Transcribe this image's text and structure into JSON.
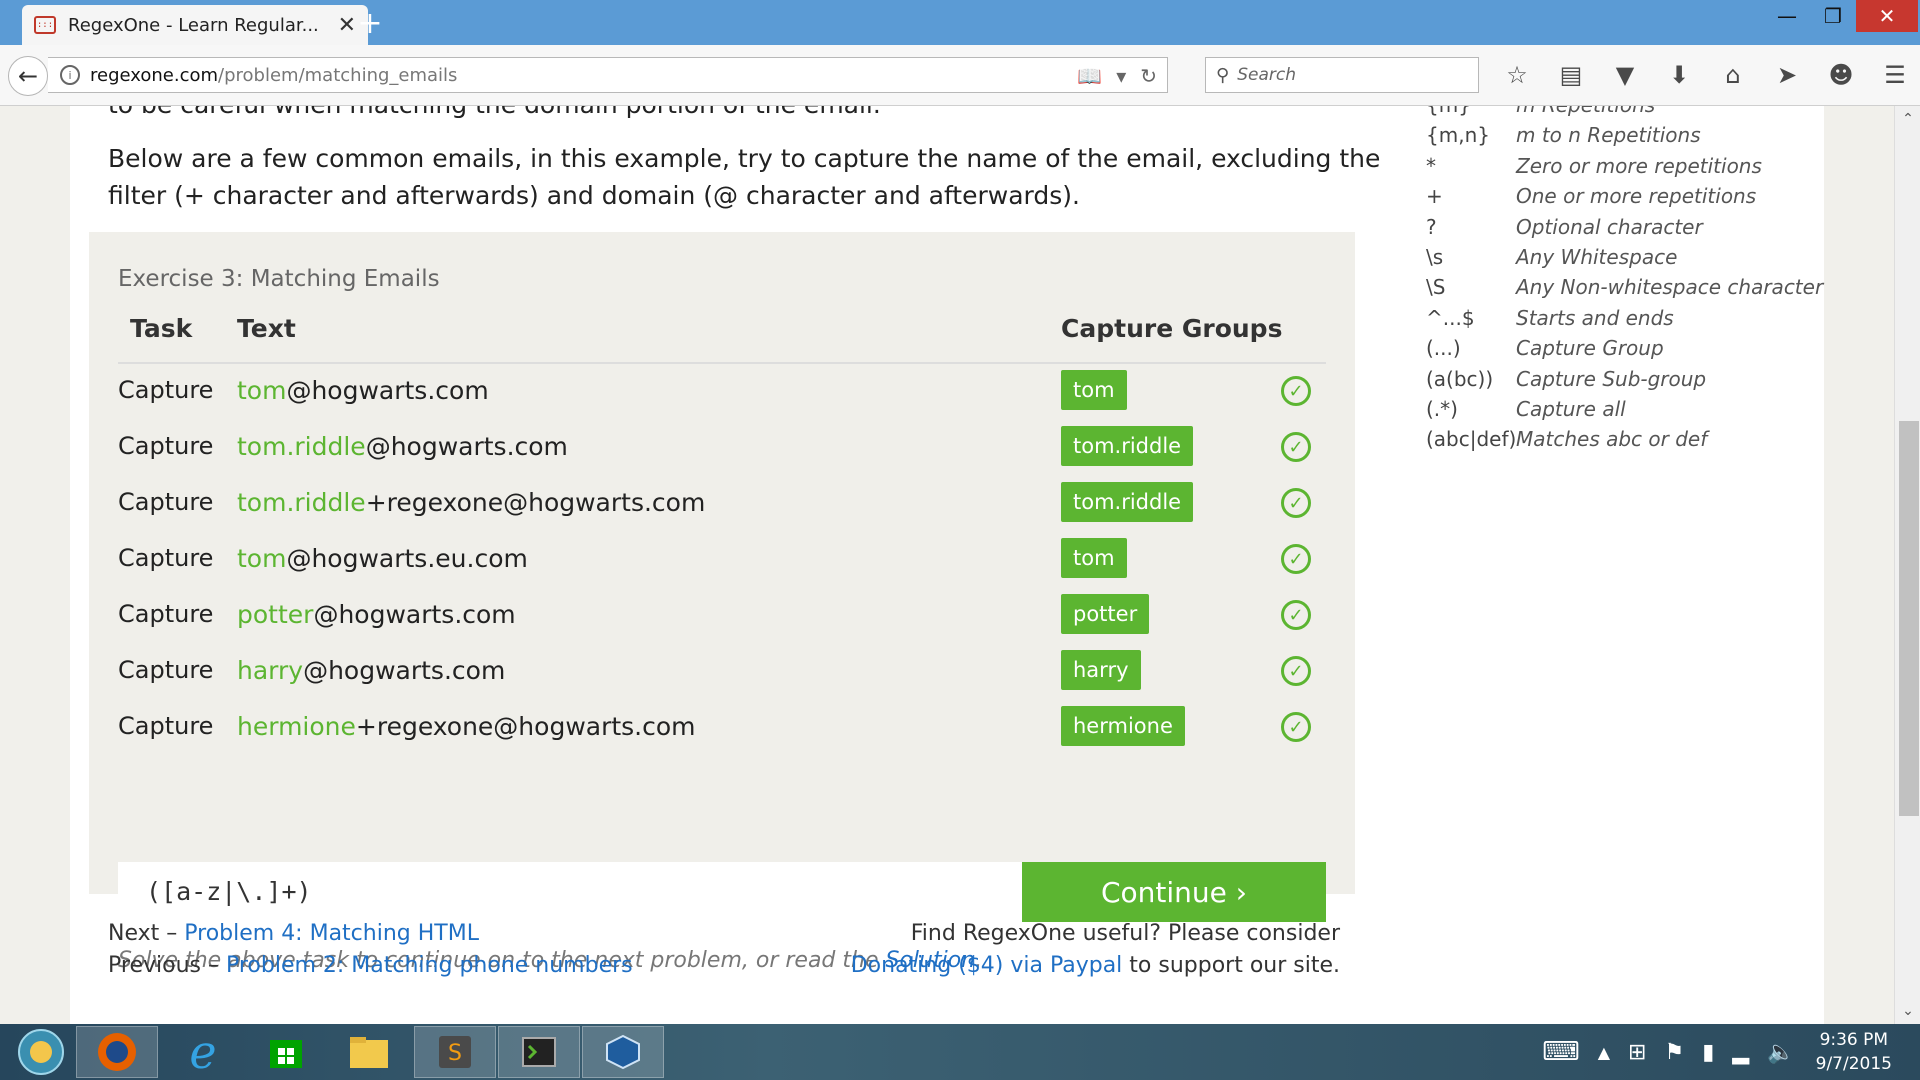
{
  "browser": {
    "tab_title": "RegexOne - Learn Regular...",
    "url_host": "regexone.com",
    "url_path": "/problem/matching_emails",
    "search_placeholder": "Search",
    "new_tab": "+",
    "tab_close": "✕"
  },
  "page": {
    "intro_cut": "to be careful when matching the domain portion of the email.",
    "intro": "Below are a few common emails, in this example, try to capture the name of the email, excluding the filter (+ character and afterwards) and domain (@ character and afterwards).",
    "exercise": {
      "title": "Exercise 3: Matching Emails",
      "headers": {
        "task": "Task",
        "text": "Text",
        "groups": "Capture Groups"
      },
      "rows": [
        {
          "task": "Capture",
          "match": "tom",
          "rest": "@hogwarts.com",
          "group": "tom"
        },
        {
          "task": "Capture",
          "match": "tom.riddle",
          "rest": "@hogwarts.com",
          "group": "tom.riddle"
        },
        {
          "task": "Capture",
          "match": "tom.riddle",
          "rest": "+regexone@hogwarts.com",
          "group": "tom.riddle"
        },
        {
          "task": "Capture",
          "match": "tom",
          "rest": "@hogwarts.eu.com",
          "group": "tom"
        },
        {
          "task": "Capture",
          "match": "potter",
          "rest": "@hogwarts.com",
          "group": "potter"
        },
        {
          "task": "Capture",
          "match": "harry",
          "rest": "@hogwarts.com",
          "group": "harry"
        },
        {
          "task": "Capture",
          "match": "hermione",
          "rest": "+regexone@hogwarts.com",
          "group": "hermione"
        }
      ],
      "answer": "([a-z|\\.]+)",
      "continue_label": "Continue ›",
      "solve_text": "Solve the above task to continue on to the next problem, or read the ",
      "solution_link": "Solution",
      "solve_end": "."
    },
    "next_prefix": "Next – ",
    "next_link": "Problem 4: Matching HTML",
    "prev_prefix": "Previous – ",
    "prev_link": "Problem 2: Matching phone numbers",
    "donate_line1": "Find RegexOne useful? Please consider",
    "donate_link": "Donating ($4) via Paypal",
    "donate_end": " to support our site."
  },
  "sidebar": [
    {
      "key": "{m}",
      "desc": "m Repetitions"
    },
    {
      "key": "{m,n}",
      "desc": "m to n Repetitions"
    },
    {
      "key": "*",
      "desc": "Zero or more repetitions"
    },
    {
      "key": "+",
      "desc": "One or more repetitions"
    },
    {
      "key": "?",
      "desc": "Optional character"
    },
    {
      "key": "\\s",
      "desc": "Any Whitespace"
    },
    {
      "key": "\\S",
      "desc": "Any Non-whitespace character"
    },
    {
      "key": "^...$",
      "desc": "Starts and ends"
    },
    {
      "key": "(...)",
      "desc": "Capture Group"
    },
    {
      "key": "(a(bc))",
      "desc": "Capture Sub-group"
    },
    {
      "key": "(.*)",
      "desc": "Capture all"
    },
    {
      "key": "(abc|def)",
      "desc": "Matches abc or def"
    }
  ],
  "taskbar": {
    "time": "9:36 PM",
    "date": "9/7/2015"
  },
  "colors": {
    "accent_green": "#5cb531",
    "link_blue": "#1f6fc4",
    "titlebar": "#5b9bd5"
  }
}
